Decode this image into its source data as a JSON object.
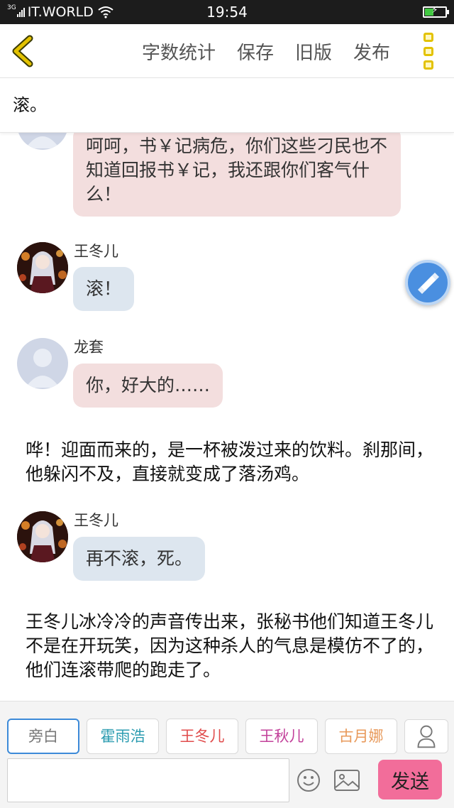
{
  "status_bar": {
    "network": "3G",
    "carrier": "IT.WORLD",
    "time": "19:54",
    "battery_charging": true
  },
  "toolbar": {
    "items": [
      "字数统计",
      "保存",
      "旧版",
      "发布"
    ],
    "accent_color": "#e3c200"
  },
  "title": "滚。",
  "messages": [
    {
      "avatar": "default",
      "name": "",
      "text": "呵呵，书￥记病危，你们这些刁民也不知道回报书￥记，我还跟你们客气什么！",
      "color": "#f3dede"
    },
    {
      "avatar": "anime",
      "name": "王冬儿",
      "text": "滚！",
      "color": "#dde6ef"
    },
    {
      "avatar": "default",
      "name": "龙套",
      "text": "你，好大的……",
      "color": "#f3dede"
    },
    {
      "narration": "哗！迎面而来的，是一杯被泼过来的饮料。刹那间，他躲闪不及，直接就变成了落汤鸡。"
    },
    {
      "avatar": "anime",
      "name": "王冬儿",
      "text": "再不滚，死。",
      "color": "#dde6ef"
    },
    {
      "narration": "王冬儿冰冷冷的声音传出来，张秘书他们知道王冬儿不是在开玩笑，因为这种杀人的气息是模仿不了的，他们连滚带爬的跑走了。"
    }
  ],
  "characters": [
    {
      "label": "旁白",
      "color": "#777777"
    },
    {
      "label": "霍雨浩",
      "color": "#2a9bb0"
    },
    {
      "label": "王冬儿",
      "color": "#e04b4b"
    },
    {
      "label": "王秋儿",
      "color": "#c2409a"
    },
    {
      "label": "古月娜",
      "color": "#e8995a"
    }
  ],
  "input": {
    "value": "",
    "placeholder": ""
  },
  "send_label": "发送",
  "send_color": "#f26d9a",
  "icons": [
    "back-icon",
    "more-icon",
    "float-edit-icon",
    "person-icon",
    "emoji-icon",
    "image-icon"
  ]
}
